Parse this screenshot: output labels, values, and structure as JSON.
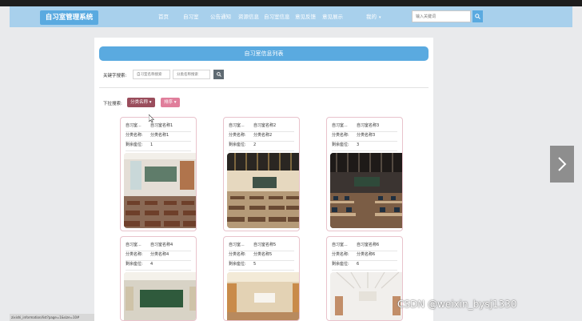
{
  "navbar": {
    "brand": "自习室管理系统",
    "items": [
      {
        "label": "首页"
      },
      {
        "label": "自习室"
      },
      {
        "label": "公告通知"
      },
      {
        "label": "资源信息"
      },
      {
        "label": "自习室信息"
      },
      {
        "label": "意见反馈"
      },
      {
        "label": "意见展示"
      }
    ],
    "mine": {
      "label": "我的",
      "icon": "caret-down-icon"
    },
    "search": {
      "placeholder": "输入关键词",
      "icon": "search-icon"
    }
  },
  "page": {
    "title": "自习室信息列表",
    "keyword_label": "关键字搜索:",
    "filter_inputs": [
      {
        "placeholder": "自习室名称搜索"
      },
      {
        "placeholder": "分类名称搜索"
      }
    ],
    "search_button_icon": "search-icon",
    "dropdown_label": "下拉搜索:",
    "dropdowns": [
      {
        "label": "分类名称",
        "color": "#9a4d5c"
      },
      {
        "label": "排序",
        "color": "#e07e9b"
      }
    ]
  },
  "rooms": [
    {
      "name_label": "自习室...",
      "name": "自习室名称1",
      "cat_label": "分类名称:",
      "category": "分类名称1",
      "seat_label": "剩余座位:",
      "seats": "1",
      "image": "classroom-photo"
    },
    {
      "name_label": "自习室...",
      "name": "自习室名称2",
      "cat_label": "分类名称:",
      "category": "分类名称2",
      "seat_label": "剩余座位:",
      "seats": "2",
      "image": "classroom-photo"
    },
    {
      "name_label": "自习室...",
      "name": "自习室名称3",
      "cat_label": "分类名称:",
      "category": "分类名称3",
      "seat_label": "剩余座位:",
      "seats": "3",
      "image": "computer-lab-photo"
    },
    {
      "name_label": "自习室...",
      "name": "自习室名称4",
      "cat_label": "分类名称:",
      "category": "分类名称4",
      "seat_label": "剩余座位:",
      "seats": "4",
      "image": "classroom-photo"
    },
    {
      "name_label": "自习室...",
      "name": "自习室名称5",
      "cat_label": "分类名称:",
      "category": "分类名称5",
      "seat_label": "剩余座位:",
      "seats": "5",
      "image": "classroom-photo"
    },
    {
      "name_label": "自习室...",
      "name": "自习室名称6",
      "cat_label": "分类名称:",
      "category": "分类名称6",
      "seat_label": "剩余座位:",
      "seats": "6",
      "image": "classroom-photo"
    }
  ],
  "next_arrow": {
    "icon": "chevron-right-icon"
  },
  "statusbar": {
    "text": "zixishi_information/list?page=1&size=10#"
  },
  "watermark": "CSDN @weixin_bysj1330",
  "colors": {
    "navbar": "#a8d0ec",
    "accent": "#5aaae0",
    "card_border": "#e9c3cc",
    "background": "#e9eaec"
  }
}
